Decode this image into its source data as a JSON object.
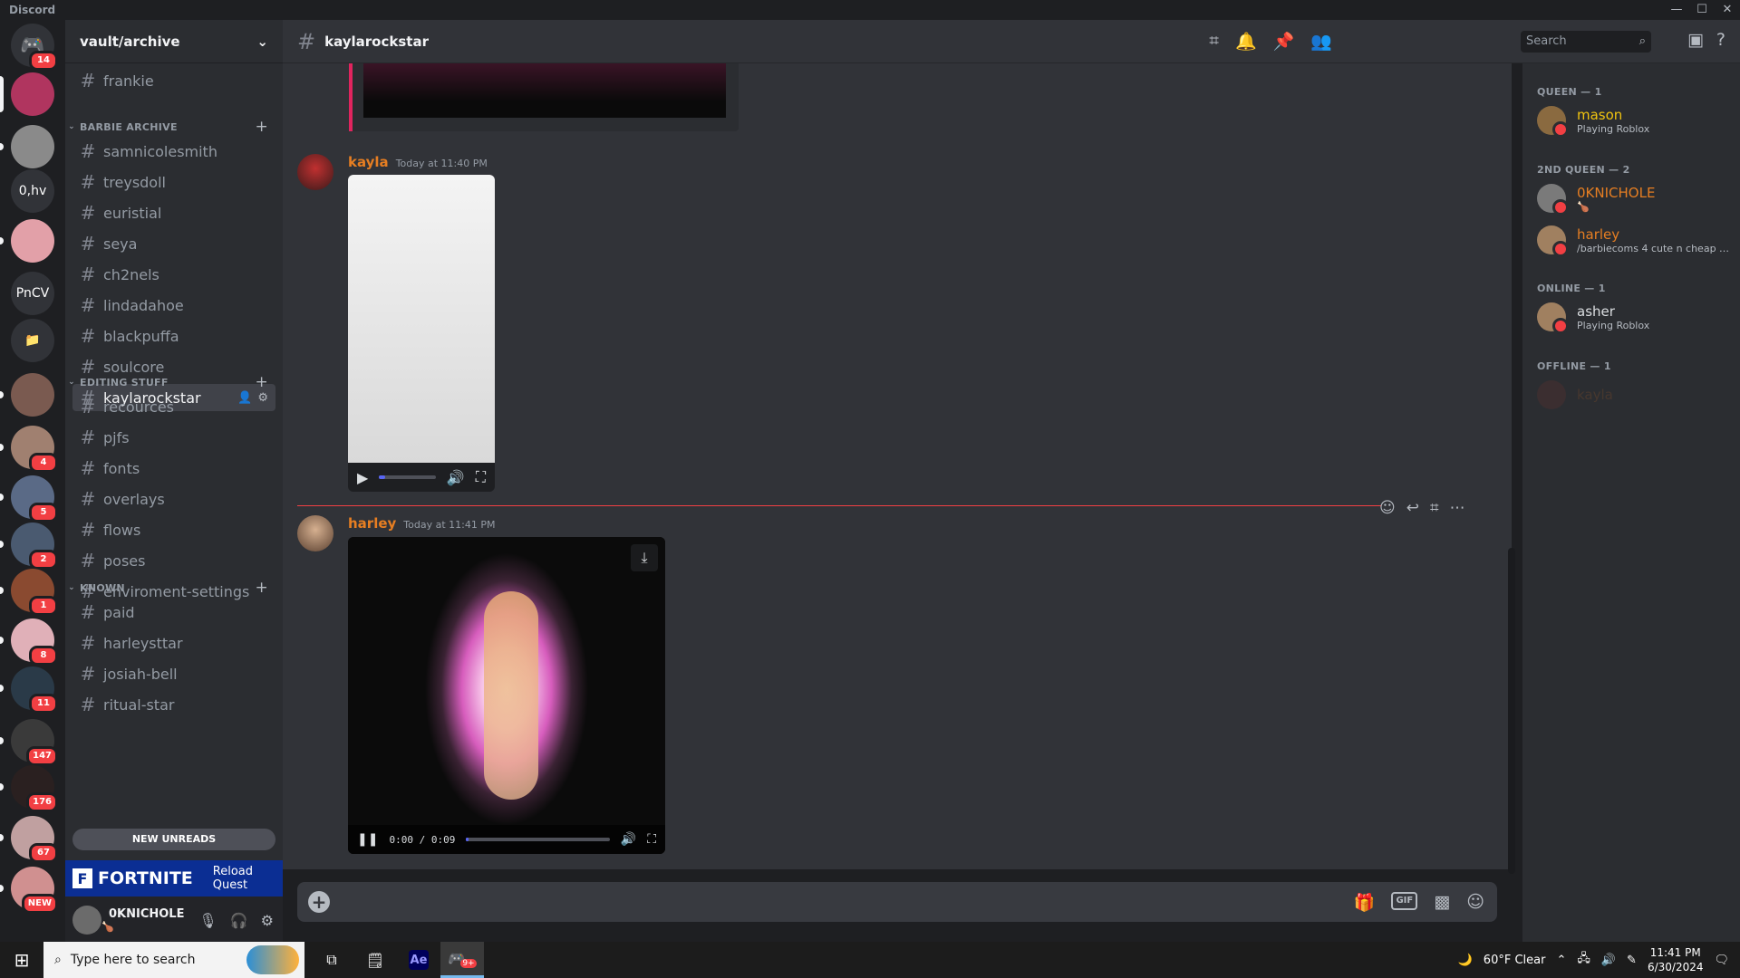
{
  "app": {
    "title": "Discord",
    "window_controls": [
      "—",
      "☐",
      "✕"
    ]
  },
  "rail": {
    "home_badge": "14",
    "servers": [
      {
        "label": "",
        "badge": "",
        "color": "#b0355f"
      },
      {
        "label": "",
        "badge": "",
        "color": "#8a8a8a"
      },
      {
        "label": "0,hv",
        "badge": "",
        "color": "#313338"
      },
      {
        "label": "",
        "badge": "",
        "color": "#e2a0a8"
      },
      {
        "label": "PnCV",
        "badge": "",
        "color": "#313338"
      },
      {
        "label": "📁",
        "badge": "",
        "color": "#313338"
      },
      {
        "label": "",
        "badge": "",
        "color": "#7a5a50"
      },
      {
        "label": "",
        "badge": "4",
        "color": "#a08070"
      },
      {
        "label": "",
        "badge": "5",
        "color": "#5a6a86"
      },
      {
        "label": "",
        "badge": "2",
        "color": "#4a5a70"
      },
      {
        "label": "",
        "badge": "1",
        "color": "#8a4a30"
      },
      {
        "label": "",
        "badge": "8",
        "color": "#e0b0b8"
      },
      {
        "label": "",
        "badge": "11",
        "color": "#2a3a48"
      },
      {
        "label": "",
        "badge": "147",
        "color": "#3a3a3a"
      },
      {
        "label": "",
        "badge": "176",
        "color": "#2a2020"
      },
      {
        "label": "",
        "badge": "67",
        "color": "#c0a0a0"
      },
      {
        "label": "",
        "badge": "NEW",
        "color": "#d09090"
      }
    ]
  },
  "sidebar": {
    "guild_name": "vault/archive",
    "top_channel": "frankie",
    "categories": [
      {
        "name": "BARBIE ARCHIVE",
        "channels": [
          "samnicolesmith",
          "treysdoll",
          "euristial",
          "seya",
          "ch2nels",
          "lindadahoe",
          "blackpuffa",
          "soulcore",
          "kaylarockstar"
        ]
      },
      {
        "name": "EDITING STUFF",
        "channels": [
          "recources",
          "pjfs",
          "fonts",
          "overlays",
          "flows",
          "poses",
          "enviroment-settings"
        ]
      },
      {
        "name": "KNOWN",
        "channels": [
          "paid",
          "harleysttar",
          "josiah-bell",
          "ritual-star"
        ]
      }
    ],
    "new_unreads": "NEW UNREADS",
    "quest": {
      "brand": "FORTNITE",
      "label": "Reload Quest"
    },
    "user": {
      "name": "0KNICHOLE",
      "status": "🍗"
    }
  },
  "header": {
    "channel": "kaylarockstar",
    "search_placeholder": "Search"
  },
  "messages": [
    {
      "author": "kayla",
      "time": "Today at 11:40 PM",
      "color": "#e67e22"
    },
    {
      "author": "harley",
      "time": "Today at 11:41 PM",
      "color": "#e67e22",
      "video_time": "0:00 / 0:09"
    }
  ],
  "members": {
    "groups": [
      {
        "role": "QUEEN — 1",
        "members": [
          {
            "name": "mason",
            "activity": "Playing Roblox",
            "color": "#f1c40f"
          }
        ]
      },
      {
        "role": "2ND QUEEN — 2",
        "members": [
          {
            "name": "0KNICHOLE",
            "activity": "🍗",
            "color": "#e67e22"
          },
          {
            "name": "harley",
            "activity": "/barbiecoms 4 cute n cheap e...",
            "color": "#e67e22"
          }
        ]
      },
      {
        "role": "ONLINE — 1",
        "members": [
          {
            "name": "asher",
            "activity": "Playing Roblox",
            "color": "#dbdee1"
          }
        ]
      },
      {
        "role": "OFFLINE — 1",
        "members": [
          {
            "name": "kayla",
            "activity": "",
            "color": "#7a4a2a"
          }
        ]
      }
    ]
  },
  "taskbar": {
    "search_placeholder": "Type here to search",
    "weather": "60°F  Clear",
    "time": "11:41 PM",
    "date": "6/30/2024",
    "discord_badge": "9+"
  }
}
